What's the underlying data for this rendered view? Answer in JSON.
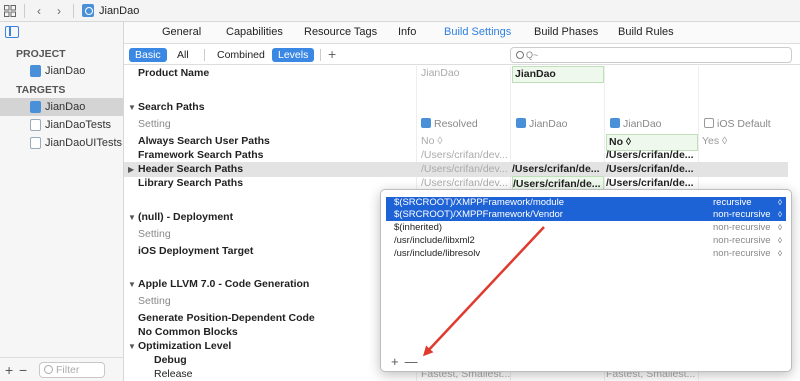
{
  "nav": {
    "file_title": "JianDao"
  },
  "sidebar": {
    "project_header": "PROJECT",
    "project_item": "JianDao",
    "targets_header": "TARGETS",
    "targets": [
      "JianDao",
      "JianDaoTests",
      "JianDaoUITests"
    ],
    "filter_placeholder": "Filter"
  },
  "tabs": [
    "General",
    "Capabilities",
    "Resource Tags",
    "Info",
    "Build Settings",
    "Build Phases",
    "Build Rules"
  ],
  "filterbar": {
    "basic": "Basic",
    "all": "All",
    "combined": "Combined",
    "levels": "Levels",
    "search_placeholder": "Q~"
  },
  "grid": {
    "product_name": {
      "label": "Product Name",
      "resolved": "JianDao",
      "target": "JianDao"
    },
    "search_paths": {
      "title": "Search Paths",
      "setting": "Setting",
      "col_resolved": "Resolved",
      "col_target": "JianDao",
      "col_project": "JianDao",
      "col_default": "iOS Default",
      "always_search": {
        "label": "Always Search User Paths",
        "resolved": "No ◊",
        "project": "No ◊",
        "default": "Yes ◊"
      },
      "framework": {
        "label": "Framework Search Paths",
        "resolved": "/Users/crifan/dev...",
        "project": "/Users/crifan/de..."
      },
      "header": {
        "label": "Header Search Paths",
        "resolved": "/Users/crifan/dev...",
        "target": "/Users/crifan/de...",
        "project": "/Users/crifan/de..."
      },
      "library": {
        "label": "Library Search Paths",
        "resolved": "/Users/crifan/dev...",
        "target": "/Users/crifan/de...",
        "project": "/Users/crifan/de..."
      }
    },
    "deployment": {
      "title": "(null) - Deployment",
      "setting": "Setting",
      "ios_target": "iOS Deployment Target"
    },
    "llvm": {
      "title": "Apple LLVM 7.0 - Code Generation",
      "setting": "Setting",
      "gen_pic": "Generate Position-Dependent Code",
      "no_common": "No Common Blocks",
      "opt_level": "Optimization Level",
      "debug": "Debug",
      "release": "Release",
      "release_resolved": "Fastest, Smallest...",
      "release_project": "Fastest, Smallest..."
    }
  },
  "popover": {
    "rows": [
      {
        "path": "$(SRCROOT)/XMPPFramework/module",
        "mode": "recursive"
      },
      {
        "path": "$(SRCROOT)/XMPPFramework/Vendor",
        "mode": "non-recursive"
      },
      {
        "path": "$(inherited)",
        "mode": "non-recursive"
      },
      {
        "path": "/usr/include/libxml2",
        "mode": "non-recursive"
      },
      {
        "path": "/usr/include/libresolv",
        "mode": "non-recursive"
      }
    ],
    "step_glyph": "◊",
    "add": "+",
    "remove": "—"
  },
  "icons": {
    "grid": "grid-icon",
    "back": "chevron-left-icon",
    "forward": "chevron-right-icon"
  },
  "colors": {
    "accent": "#2f7fe0",
    "selection": "#1e63d6",
    "annotation": "#e03a2f"
  }
}
